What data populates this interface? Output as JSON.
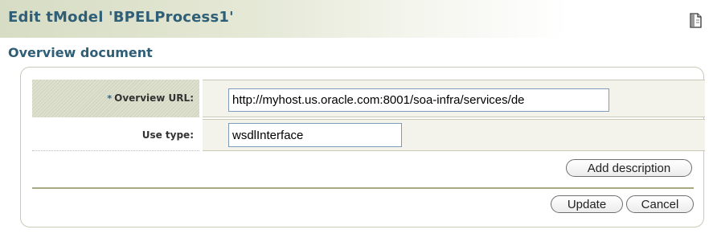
{
  "header": {
    "title": "Edit tModel 'BPELProcess1'",
    "icon": "page-icon"
  },
  "section": {
    "title": "Overview document"
  },
  "form": {
    "overview_url": {
      "required_marker": "*",
      "label": "Overview URL:",
      "value": "http://myhost.us.oracle.com:8001/soa-infra/services/de"
    },
    "use_type": {
      "label": "Use type:",
      "value": "wsdlInterface"
    }
  },
  "buttons": {
    "add_description": "Add description",
    "update": "Update",
    "cancel": "Cancel"
  },
  "colors": {
    "title_text": "#2f5e77",
    "label_band": "#d4d8c2",
    "separator": "#a8aa86"
  }
}
